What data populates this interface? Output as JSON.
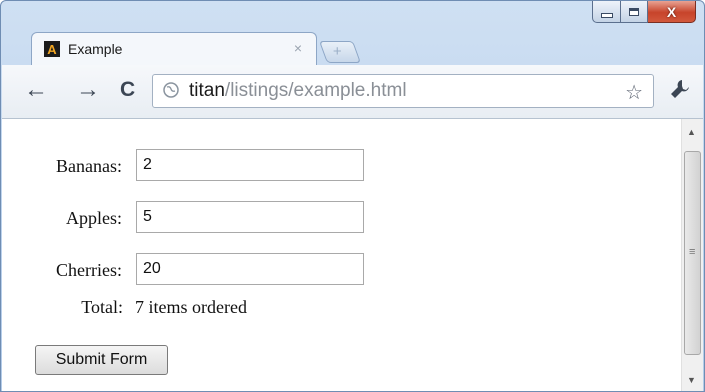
{
  "tab": {
    "title": "Example",
    "close": "×",
    "favicon_letter": "A"
  },
  "new_tab": {
    "glyph": "+"
  },
  "nav": {
    "back": "←",
    "forward": "→",
    "reload": "C"
  },
  "address": {
    "host": "titan",
    "path": "/listings/example.html"
  },
  "toolbar": {
    "bookmark_star": "☆"
  },
  "form": {
    "fields": [
      {
        "label": "Bananas:",
        "value": "2"
      },
      {
        "label": "Apples:",
        "value": "5"
      },
      {
        "label": "Cherries:",
        "value": "20"
      }
    ],
    "total_label": "Total:",
    "total_value": "7 items ordered",
    "submit_label": "Submit Form"
  },
  "icons": [
    "minimize-icon",
    "maximize-icon",
    "close-icon",
    "favicon-icon",
    "tab-close-icon",
    "new-tab-icon",
    "back-icon",
    "forward-icon",
    "reload-icon",
    "globe-icon",
    "star-icon",
    "wrench-icon"
  ],
  "colors": {
    "close_button": "#c7442b",
    "window_frame": "#bcd2ec",
    "favicon_accent": "#f2a622"
  }
}
